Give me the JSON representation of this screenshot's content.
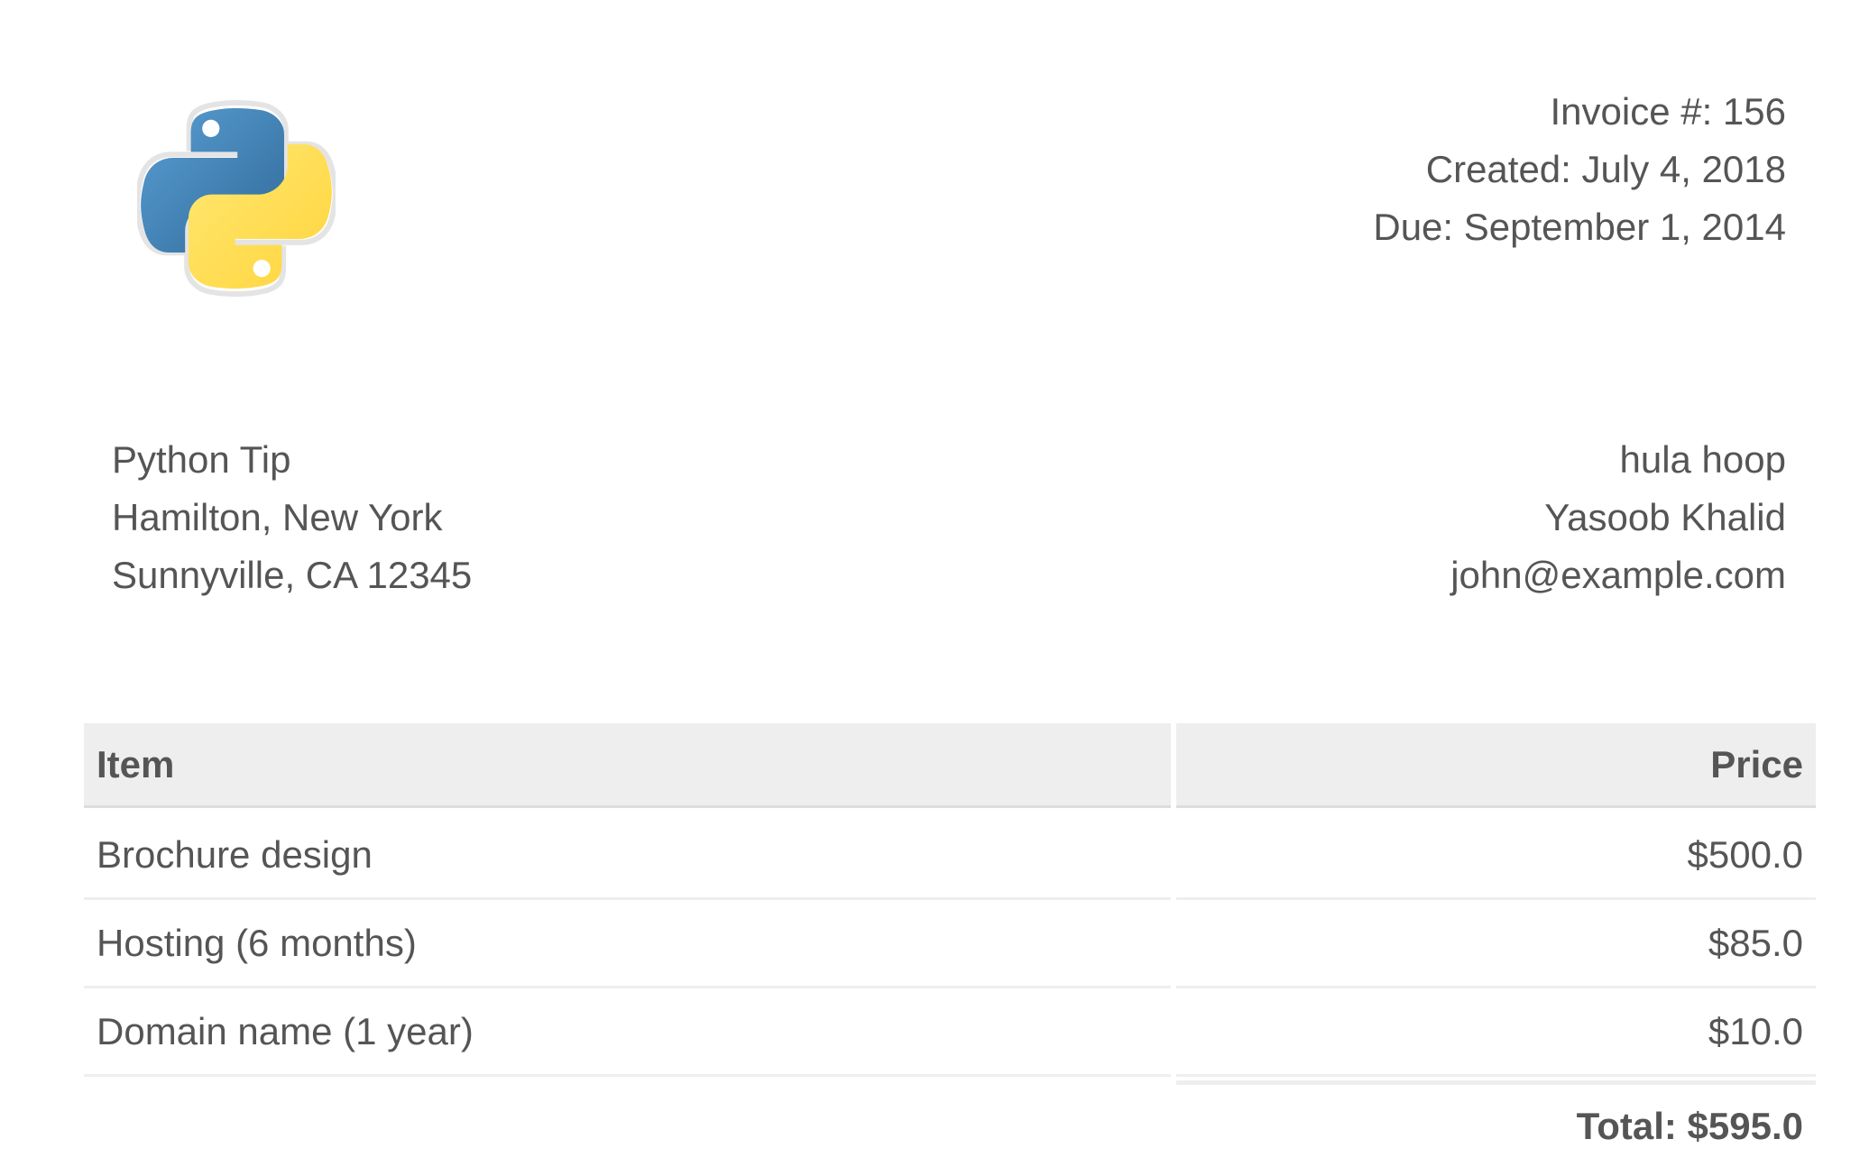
{
  "logo": {
    "name": "python-logo",
    "colors": {
      "blue": "#3b73a8",
      "yellow": "#ffd43b"
    }
  },
  "invoice": {
    "number": "Invoice #: 156",
    "created": "Created: July 4, 2018",
    "due": "Due: September 1, 2014"
  },
  "from": {
    "line1": "Python Tip",
    "line2": "Hamilton, New York",
    "line3": "Sunnyville, CA 12345"
  },
  "to": {
    "line1": "hula hoop",
    "line2": "Yasoob Khalid",
    "line3": "john@example.com"
  },
  "table": {
    "headers": {
      "item": "Item",
      "price": "Price"
    },
    "rows": [
      {
        "item": "Brochure design",
        "price": "$500.0"
      },
      {
        "item": "Hosting (6 months)",
        "price": "$85.0"
      },
      {
        "item": "Domain name (1 year)",
        "price": "$10.0"
      }
    ],
    "total": "Total: $595.0"
  },
  "colors": {
    "text": "#555555",
    "heading_bg": "#eeeeee",
    "border": "#eeeeee"
  }
}
